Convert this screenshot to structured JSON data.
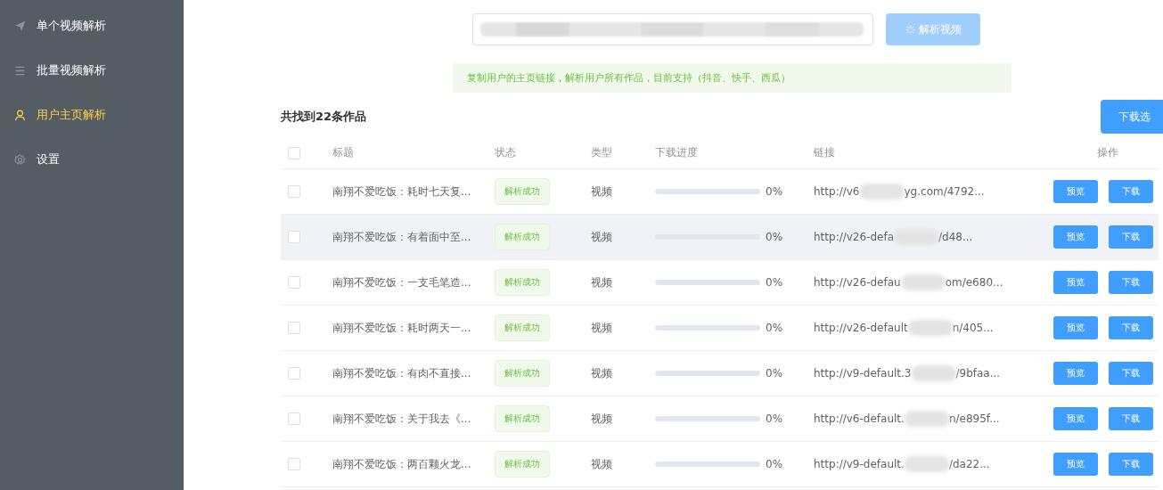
{
  "sidebar": {
    "items": [
      {
        "label": "单个视频解析",
        "selected": false
      },
      {
        "label": "批量视频解析",
        "selected": false
      },
      {
        "label": "用户主页解析",
        "selected": true
      },
      {
        "label": "设置",
        "selected": false
      }
    ]
  },
  "search": {
    "parse_button": "解析视频",
    "parse_disabled": true
  },
  "alert": "复制用户的主页链接，解析用户所有作品，目前支持（抖音、快手、西瓜）",
  "result_title": "共找到22条作品",
  "download_selected_button": "下载选",
  "table": {
    "columns": [
      "标题",
      "状态",
      "类型",
      "下载进度",
      "链接",
      "操作"
    ],
    "all_checked": false,
    "rows": [
      {
        "checked": false,
        "highlighted": false,
        "title": "南翔不爱吃饭：耗时七天复...",
        "status": "解析成功",
        "type": "视频",
        "level": 0,
        "progress": "0%",
        "link_start": "http://v6",
        "link_end": "yg.com/4792...",
        "preview": "预览",
        "download": "下载"
      },
      {
        "checked": false,
        "highlighted": true,
        "title": "南翔不爱吃饭：有着面中至...",
        "status": "解析成功",
        "type": "视频",
        "level": 0,
        "progress": "0%",
        "link_start": "http://v26-defa",
        "link_end": "/d48...",
        "preview": "预览",
        "download": "下载"
      },
      {
        "checked": false,
        "highlighted": false,
        "title": "南翔不爱吃饭：一支毛笔造...",
        "status": "解析成功",
        "type": "视频",
        "level": 0,
        "progress": "0%",
        "link_start": "http://v26-defau",
        "link_end": "om/e680...",
        "preview": "预览",
        "download": "下载"
      },
      {
        "checked": false,
        "highlighted": false,
        "title": "南翔不爱吃饭：耗时两天一...",
        "status": "解析成功",
        "type": "视频",
        "level": 0,
        "progress": "0%",
        "link_start": "http://v26-default",
        "link_end": "n/405...",
        "preview": "预览",
        "download": "下载"
      },
      {
        "checked": false,
        "highlighted": false,
        "title": "南翔不爱吃饭：有肉不直接...",
        "status": "解析成功",
        "type": "视频",
        "level": 0,
        "progress": "0%",
        "link_start": "http://v9-default.3",
        "link_end": "/9bfaa...",
        "preview": "预览",
        "download": "下载"
      },
      {
        "checked": false,
        "highlighted": false,
        "title": "南翔不爱吃饭：关于我去《...",
        "status": "解析成功",
        "type": "视频",
        "level": 0,
        "progress": "0%",
        "link_start": "http://v6-default.",
        "link_end": "n/e895f...",
        "preview": "预览",
        "download": "下载"
      },
      {
        "checked": false,
        "highlighted": false,
        "title": "南翔不爱吃饭：两百颗火龙...",
        "status": "解析成功",
        "type": "视频",
        "level": 0,
        "progress": "0%",
        "link_start": "http://v9-default.",
        "link_end": "/da22...",
        "preview": "预览",
        "download": "下载"
      }
    ]
  }
}
